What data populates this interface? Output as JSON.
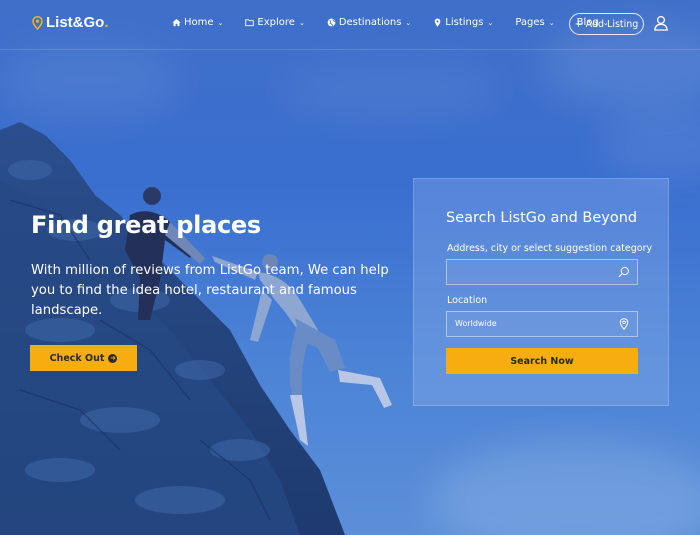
{
  "brand": {
    "name": "List&Go",
    "dot": ".",
    "pin_color": "#f5b512"
  },
  "nav": {
    "items": [
      {
        "label": "Home",
        "icon": "home-icon"
      },
      {
        "label": "Explore",
        "icon": "folder-icon"
      },
      {
        "label": "Destinations",
        "icon": "globe-icon"
      },
      {
        "label": "Listings",
        "icon": "map-pin-icon"
      },
      {
        "label": "Pages",
        "icon": ""
      },
      {
        "label": "Blog",
        "icon": ""
      }
    ],
    "add_listing": "+ Add Listing",
    "user": "user-icon"
  },
  "hero": {
    "headline": "Find great places",
    "subline": "With million of reviews from ListGo team, We can help you to find the idea hotel, restaurant and famous landscape.",
    "cta": "Check Out"
  },
  "search": {
    "title": "Search ListGo and Beyond",
    "query_label": "Address, city or select suggestion category",
    "query_value": "",
    "location_label": "Location",
    "location_value": "Worldwide",
    "button": "Search Now"
  },
  "colors": {
    "accent": "#f5ad0f",
    "overlay": "#3a6fd0"
  }
}
